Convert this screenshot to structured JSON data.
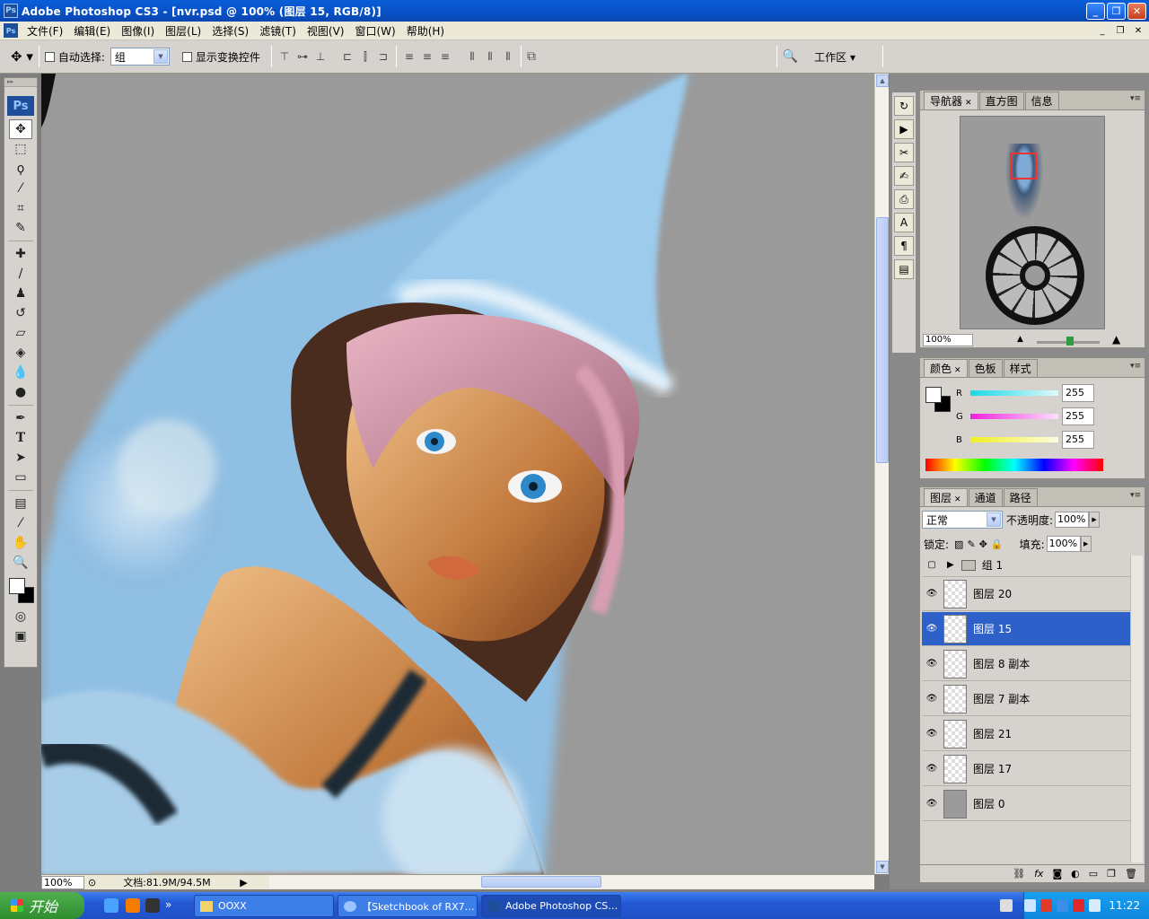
{
  "window": {
    "title": "Adobe Photoshop CS3 - [nvr.psd @ 100% (图层 15, RGB/8)]",
    "app_icon": "Ps"
  },
  "menubar": {
    "items": [
      "文件(F)",
      "编辑(E)",
      "图像(I)",
      "图层(L)",
      "选择(S)",
      "滤镜(T)",
      "视图(V)",
      "窗口(W)",
      "帮助(H)"
    ]
  },
  "options": {
    "auto_select_label": "自动选择:",
    "auto_select_value": "组",
    "show_transform_label": "显示变换控件",
    "workspace_label": "工作区 ▾"
  },
  "tools": {
    "logo": "Ps",
    "items": [
      "move-icon",
      "marquee-icon",
      "lasso-icon",
      "magic-wand-icon",
      "crop-icon",
      "eyedropper-slice-icon",
      "healing-icon",
      "brush-icon",
      "stamp-icon",
      "history-brush-icon",
      "eraser-icon",
      "bucket-icon",
      "blur-icon",
      "dodge-icon",
      "pen-icon",
      "type-icon",
      "path-select-icon",
      "shape-icon",
      "notes-icon",
      "eyedropper-icon",
      "hand-icon",
      "zoom-icon"
    ]
  },
  "status": {
    "zoom": "100%",
    "doc_info": "文档:81.9M/94.5M"
  },
  "navigator": {
    "tabs": [
      "导航器",
      "直方图",
      "信息"
    ],
    "zoom": "100%"
  },
  "color_panel": {
    "tabs": [
      "颜色",
      "色板",
      "样式"
    ],
    "channels": [
      {
        "name": "R",
        "value": "255",
        "color": "#18d8e8"
      },
      {
        "name": "G",
        "value": "255",
        "color": "#f020e0"
      },
      {
        "name": "B",
        "value": "255",
        "color": "#f0f020"
      }
    ]
  },
  "layers_panel": {
    "tabs": [
      "图层",
      "通道",
      "路径"
    ],
    "blend_mode": "正常",
    "opacity_label": "不透明度:",
    "opacity": "100%",
    "lock_label": "锁定:",
    "fill_label": "填充:",
    "fill": "100%",
    "group_name": "组 1",
    "layers": [
      {
        "name": "图层 20",
        "selected": false
      },
      {
        "name": "图层 15",
        "selected": true
      },
      {
        "name": "图层 8 副本",
        "selected": false
      },
      {
        "name": "图层 7 副本",
        "selected": false
      },
      {
        "name": "图层 21",
        "selected": false
      },
      {
        "name": "图层 17",
        "selected": false
      },
      {
        "name": "图层 0",
        "selected": false
      }
    ],
    "bottom_icons": [
      "link-icon",
      "fx-icon",
      "mask-icon",
      "adjustment-icon",
      "new-group-icon",
      "new-layer-icon",
      "trash-icon"
    ]
  },
  "taskbar": {
    "start_label": "开始",
    "buttons": [
      {
        "label": "OOXX",
        "active": false
      },
      {
        "label": "【Sketchbook of RX7…",
        "active": false
      },
      {
        "label": "Adobe Photoshop CS…",
        "active": true
      }
    ],
    "clock": "11:22"
  }
}
